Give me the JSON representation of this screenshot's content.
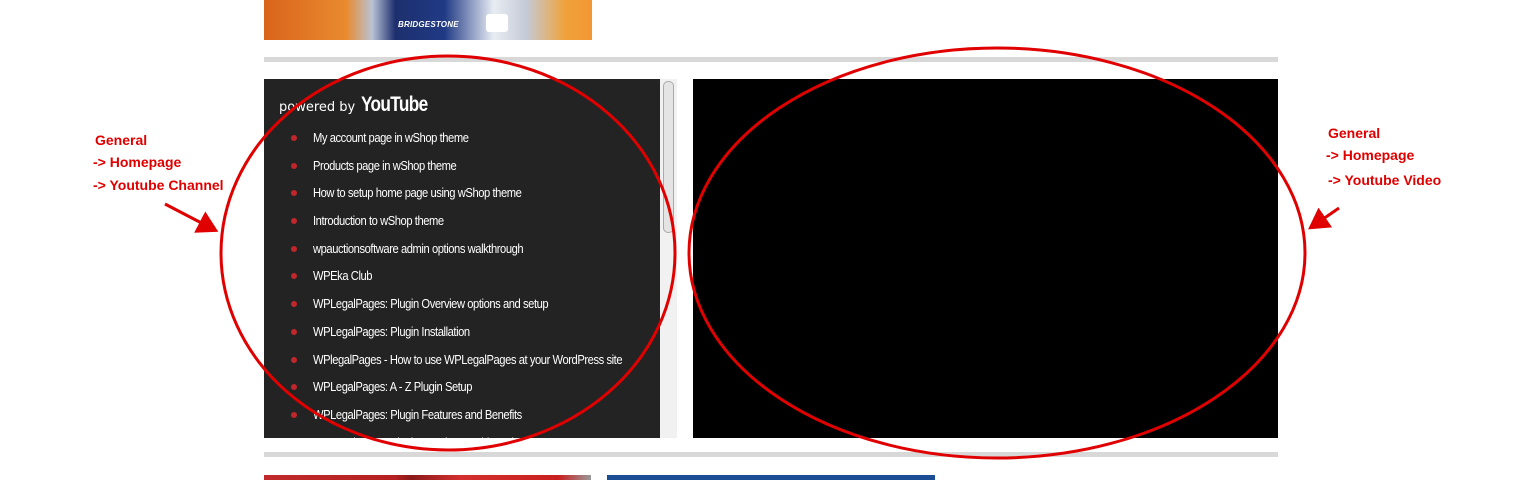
{
  "top_image": {
    "visible_text": "BRIDGESTONE"
  },
  "channel_widget": {
    "powered_by_label": "powered by",
    "youtube_logo": "YouTube",
    "bullet_color": "#c0262b",
    "videos": [
      "My account page in wShop theme",
      "Products page in wShop theme",
      "How to setup home page using wShop theme",
      "Introduction to wShop theme",
      "wpauctionsoftware admin options walkthrough",
      "WPEka Club",
      "WPLegalPages: Plugin Overview options and setup",
      "WPLegalPages: Plugin Installation",
      "WPlegalPages - How to use WPLegalPages at your WordPress site",
      "WPLegalPages: A - Z Plugin Setup",
      "WPLegalPages: Plugin Features and Benefits",
      "WPLegalPages: Plugin Member Dashboard"
    ]
  },
  "video_player": {
    "background": "#000000"
  },
  "annotations": {
    "color": "#e00000",
    "left": {
      "line1": "General",
      "line2": "-> Homepage",
      "line3": "-> Youtube Channel"
    },
    "right": {
      "line1": "General",
      "line2": "-> Homepage",
      "line3": "-> Youtube Video"
    }
  }
}
